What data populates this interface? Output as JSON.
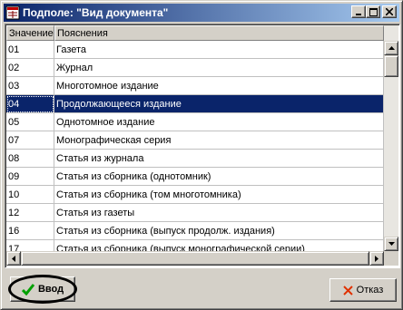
{
  "window": {
    "title": "Подполе: \"Вид документа\""
  },
  "grid": {
    "columns": [
      "Значение",
      "Пояснения"
    ],
    "selected_index": 3,
    "rows": [
      [
        "01",
        "Газета"
      ],
      [
        "02",
        "Журнал"
      ],
      [
        "03",
        "Многотомное издание"
      ],
      [
        "04",
        "Продолжающееся издание"
      ],
      [
        "05",
        "Однотомное издание"
      ],
      [
        "07",
        "Монографическая серия"
      ],
      [
        "08",
        "Статья из журнала"
      ],
      [
        "09",
        "Статья из сборника (однотомник)"
      ],
      [
        "10",
        "Статья из сборника (том многотомника)"
      ],
      [
        "12",
        "Статья из газеты"
      ],
      [
        "16",
        "Статья из сборника (выпуск продолж. издания)"
      ],
      [
        "17",
        "Статья из сборника (выпуск монографической серии)"
      ]
    ]
  },
  "buttons": {
    "ok_label": "Ввод",
    "cancel_label": "Отказ"
  },
  "colors": {
    "selection": "#0a246a",
    "face": "#d4d0c8",
    "ok_icon": "#00a000",
    "cancel_icon": "#e03000"
  },
  "icons": {
    "ok": "checkmark-icon",
    "cancel": "x-icon"
  }
}
